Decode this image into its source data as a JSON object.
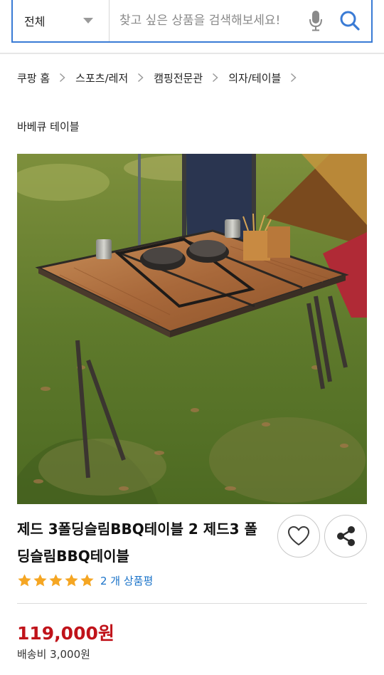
{
  "search": {
    "category": "전체",
    "placeholder": "찾고 싶은 상품을 검색해보세요!",
    "accent_color": "#3a7bd5",
    "icons": [
      "chevron-down-icon",
      "mic-icon",
      "search-icon"
    ]
  },
  "breadcrumb": {
    "items": [
      "쿠팡 홈",
      "스포츠/레저",
      "캠핑전문관",
      "의자/테이블"
    ],
    "separator_icon": "chevron-right-icon"
  },
  "subcategory": "바베큐 테이블",
  "product": {
    "image_alt": "product-photo-folding-bbq-table",
    "title": "제드 3폴딩슬림BBQ테이블 2 제드3 폴딩슬림BBQ테이블",
    "actions": [
      "heart-icon",
      "share-icon"
    ],
    "rating": 5,
    "rating_max": 5,
    "review_count_label": "2 개 상품평",
    "star_color": "#f5a623",
    "price": "119,000원",
    "price_color": "#c0131a",
    "shipping": "배송비 3,000원"
  }
}
